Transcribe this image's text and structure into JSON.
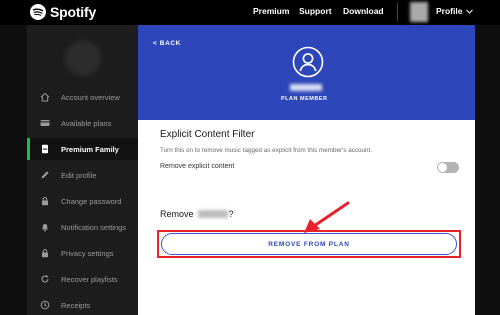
{
  "topbar": {
    "brand": "Spotify",
    "links": [
      "Premium",
      "Support",
      "Download"
    ],
    "profile_label": "Profile"
  },
  "sidebar": {
    "items": [
      {
        "label": "Account overview",
        "icon": "home-icon"
      },
      {
        "label": "Available plans",
        "icon": "card-icon"
      },
      {
        "label": "Premium Family",
        "icon": "family-icon",
        "active": true
      },
      {
        "label": "Edit profile",
        "icon": "pencil-icon"
      },
      {
        "label": "Change password",
        "icon": "lock-icon"
      },
      {
        "label": "Notification settings",
        "icon": "bell-icon"
      },
      {
        "label": "Privacy settings",
        "icon": "lock-icon"
      },
      {
        "label": "Recover playlists",
        "icon": "refresh-icon"
      },
      {
        "label": "Receipts",
        "icon": "clock-icon"
      }
    ]
  },
  "member": {
    "back_label": "< BACK",
    "role_label": "PLAN MEMBER"
  },
  "filter": {
    "title": "Explicit Content Filter",
    "description": "Turn this on to remove music tagged as explicit from this member's account.",
    "toggle_label": "Remove explicit content",
    "toggle_on": false
  },
  "remove": {
    "title_prefix": "Remove",
    "title_suffix": "?",
    "button_label": "REMOVE FROM PLAN"
  },
  "colors": {
    "accent_green": "#1db954",
    "header_blue": "#2d46b9",
    "annotation_red": "#e8232a"
  }
}
